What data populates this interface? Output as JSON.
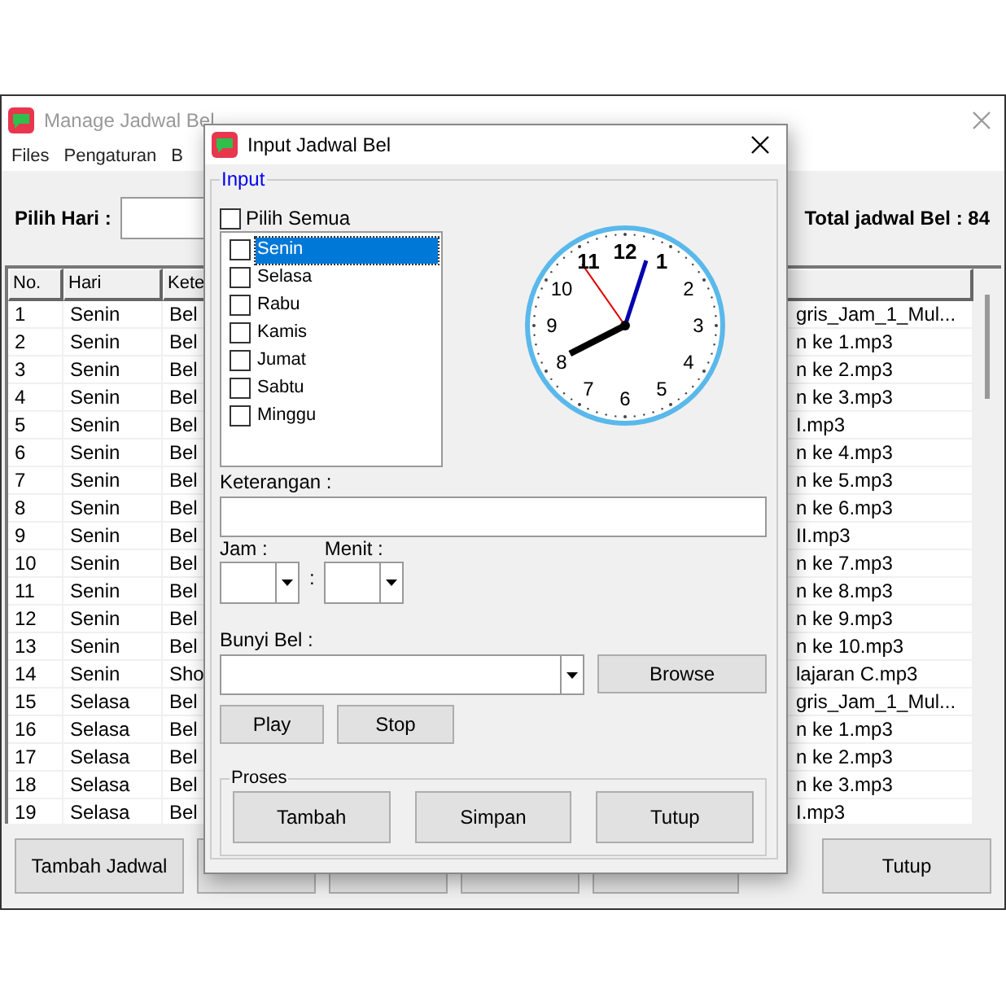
{
  "main_window": {
    "title": "Manage Jadwal Bel",
    "menu": [
      "Files",
      "Pengaturan",
      "B"
    ],
    "filter_label": "Pilih Hari :",
    "total": "Total jadwal Bel : 84",
    "table": {
      "columns": [
        "No.",
        "Hari",
        "Kete",
        ""
      ],
      "rows": [
        [
          "1",
          "Senin",
          "Bel",
          "gris_Jam_1_Mul..."
        ],
        [
          "2",
          "Senin",
          "Bel",
          "n ke 1.mp3"
        ],
        [
          "3",
          "Senin",
          "Bel",
          "n ke 2.mp3"
        ],
        [
          "4",
          "Senin",
          "Bel",
          "n ke 3.mp3"
        ],
        [
          "5",
          "Senin",
          "Bel",
          "I.mp3"
        ],
        [
          "6",
          "Senin",
          "Bel",
          "n ke 4.mp3"
        ],
        [
          "7",
          "Senin",
          "Bel",
          "n ke 5.mp3"
        ],
        [
          "8",
          "Senin",
          "Bel",
          "n ke 6.mp3"
        ],
        [
          "9",
          "Senin",
          "Bel",
          "II.mp3"
        ],
        [
          "10",
          "Senin",
          "Bel",
          "n ke 7.mp3"
        ],
        [
          "11",
          "Senin",
          "Bel",
          "n ke 8.mp3"
        ],
        [
          "12",
          "Senin",
          "Bel",
          "n ke 9.mp3"
        ],
        [
          "13",
          "Senin",
          "Bel",
          "n ke 10.mp3"
        ],
        [
          "14",
          "Senin",
          "Sho",
          "lajaran C.mp3"
        ],
        [
          "15",
          "Selasa",
          "Bel",
          "gris_Jam_1_Mul..."
        ],
        [
          "16",
          "Selasa",
          "Bel",
          "n ke 1.mp3"
        ],
        [
          "17",
          "Selasa",
          "Bel",
          "n ke 2.mp3"
        ],
        [
          "18",
          "Selasa",
          "Bel",
          "n ke 3.mp3"
        ],
        [
          "19",
          "Selasa",
          "Bel",
          "I.mp3"
        ]
      ]
    },
    "buttons": [
      {
        "kind": "labeled",
        "label": "Tambah Jadwal"
      },
      {
        "kind": "covered"
      },
      {
        "kind": "covered"
      },
      {
        "kind": "covered"
      },
      {
        "kind": "covered"
      },
      {
        "kind": "labeled",
        "label": "Tutup"
      }
    ]
  },
  "dialog": {
    "title": "Input Jadwal Bel",
    "group_label": "Input",
    "select_all": {
      "label": "Pilih Semua",
      "checked": false
    },
    "days": [
      {
        "label": "Senin",
        "checked": false,
        "selected": true
      },
      {
        "label": "Selasa",
        "checked": false,
        "selected": false
      },
      {
        "label": "Rabu",
        "checked": false,
        "selected": false
      },
      {
        "label": "Kamis",
        "checked": false,
        "selected": false
      },
      {
        "label": "Jumat",
        "checked": false,
        "selected": false
      },
      {
        "label": "Sabtu",
        "checked": false,
        "selected": false
      },
      {
        "label": "Minggu",
        "checked": false,
        "selected": false
      }
    ],
    "clock_numerals": [
      "12",
      "1",
      "2",
      "3",
      "4",
      "5",
      "6",
      "7",
      "8",
      "9",
      "10",
      "11"
    ],
    "keterangan_label": "Keterangan :",
    "jam_label": "Jam :",
    "menit_label": "Menit :",
    "separator": ":",
    "bunyi_label": "Bunyi Bel :",
    "browse": "Browse",
    "play": "Play",
    "stop": "Stop",
    "proses_label": "Proses",
    "proses_buttons": [
      "Tambah",
      "Simpan",
      "Tutup"
    ]
  }
}
